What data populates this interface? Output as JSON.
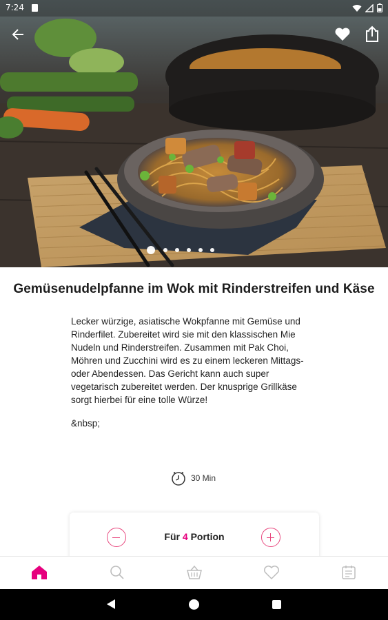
{
  "status": {
    "time": "7:24"
  },
  "hero": {
    "slide_count": 6,
    "active_slide": 1
  },
  "recipe": {
    "title": "Gemüsenudelpfanne im Wok mit Rinderstreifen und Käse",
    "description": "Lecker würzige, asiatische Wokpfanne mit Gemüse und Rinderfilet. Zubereitet wird sie mit den klassischen Mie Nudeln und Rinderstreifen. Zusammen mit Pak Choi, Möhren und Zucchini wird es zu einem leckeren Mittags- oder Abendessen. Das Gericht kann auch super vegetarisch zubereitet werden. Der knusprige Grillkäse sorgt hierbei für eine tolle Würze!",
    "extra_text": "&nbsp;",
    "duration": "30 Min"
  },
  "portion": {
    "prefix": "Für",
    "count": "4",
    "suffix": "Portion"
  },
  "colors": {
    "accent": "#e6007e",
    "accent_soft": "#e8497f"
  },
  "icons": {
    "back": "arrow-left",
    "favorite": "heart",
    "share": "share-box",
    "clock": "clock",
    "minus": "minus-circle",
    "plus": "plus-circle",
    "home": "home",
    "search": "magnifier",
    "basket": "shopping-basket",
    "favorites": "heart-outline",
    "planner": "meal-plan"
  }
}
